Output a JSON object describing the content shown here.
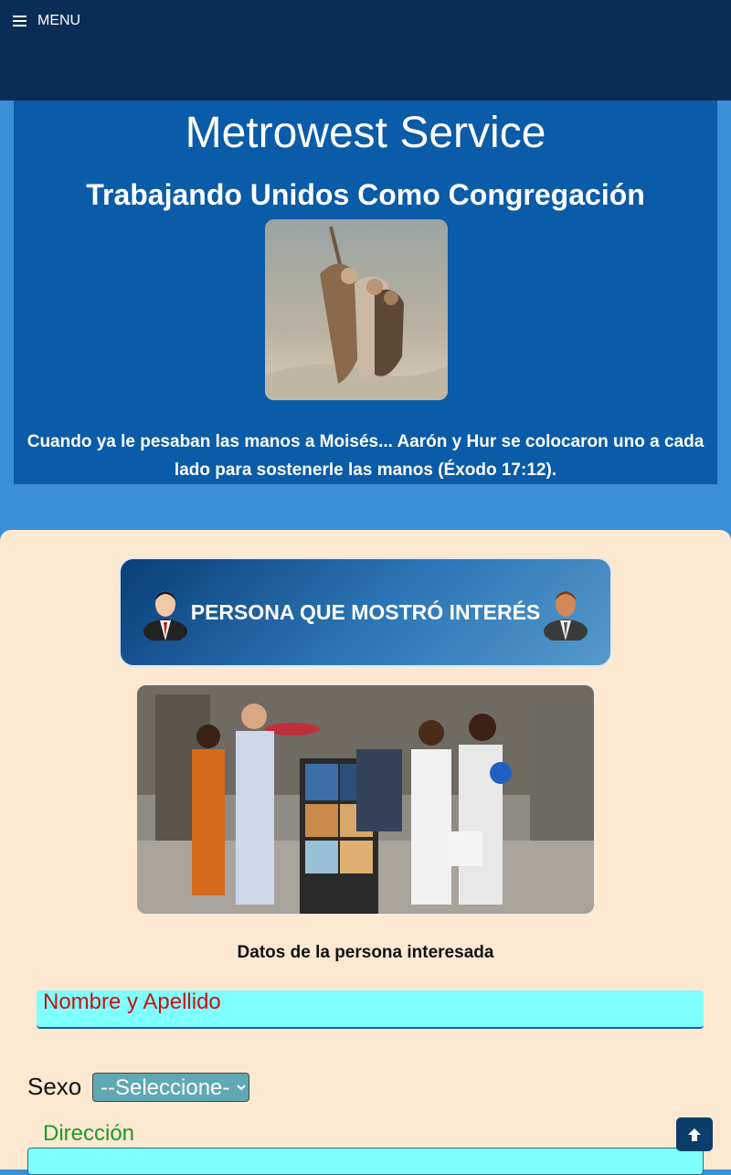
{
  "nav": {
    "menu_label": "MENU",
    "menu_icon": "hamburger-icon"
  },
  "hero": {
    "title": "Metrowest Service",
    "subtitle": "Trabajando Unidos Como Congregación",
    "quote": "Cuando ya le pesaban las manos a Moisés... Aarón y Hur se colocaron uno a cada lado para sostenerle las manos (Éxodo 17:12)."
  },
  "interest": {
    "banner_label": "PERSONA QUE MOSTRÓ INTERÉS",
    "icons": [
      "person-icon",
      "person-icon"
    ]
  },
  "form": {
    "section_title": "Datos de la persona interesada",
    "name_placeholder": "Nombre y Apellido",
    "sex_label": "Sexo",
    "sex_selected": "--Seleccione--",
    "address_label": "Dirección"
  },
  "colors": {
    "topbar": "#0b2c57",
    "hero_bg": "#0a5ba8",
    "page_bg": "#3b8fd8",
    "card_bg": "#fde8d2",
    "input_bg": "#80ffff",
    "placeholder_red": "#cc1111",
    "label_green": "#1a9a2a"
  },
  "scroll_top_icon": "arrow-up-icon"
}
